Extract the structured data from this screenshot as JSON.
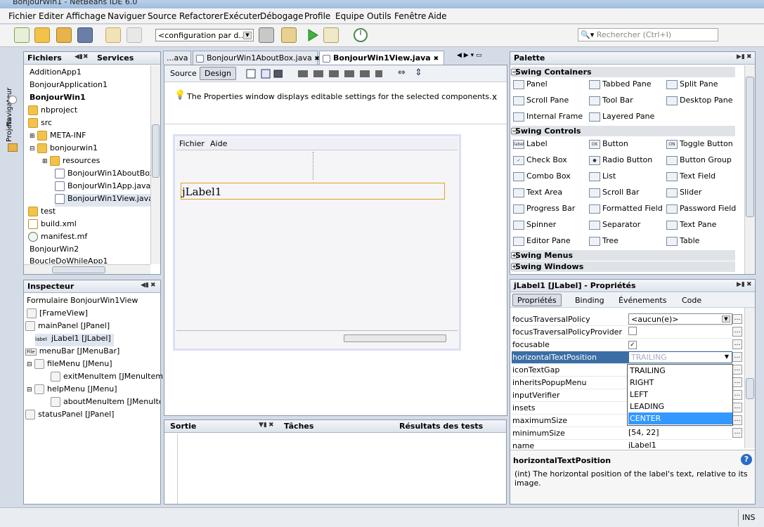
{
  "window": {
    "title": "BonjourWin1 - NetBeans IDE 6.0"
  },
  "menu": [
    "Fichier",
    "Editer",
    "Affichage",
    "Naviguer",
    "Source",
    "Refactorer",
    "Exécuter",
    "Débogage",
    "Profile",
    "Equipe",
    "Outils",
    "Fenêtre",
    "Aide"
  ],
  "toolbar": {
    "config": "<configuration par d...",
    "search_placeholder": "Rechercher (Ctrl+I)"
  },
  "left_strip": {
    "navigateur": "Navigateur",
    "projets": "Projets"
  },
  "files": {
    "tab1": "Fichiers",
    "tab2": "Services",
    "items": [
      "AdditionApp1",
      "BonjourApplication1",
      "BonjourWin1",
      "nbproject",
      "src",
      "META-INF",
      "bonjourwin1",
      "resources",
      "BonjourWin1AboutBox.",
      "BonjourWin1App.java",
      "BonjourWin1View.java",
      "test",
      "build.xml",
      "manifest.mf",
      "BonjourWin2",
      "BoucleDoWhileApp1"
    ]
  },
  "inspector": {
    "title": "Inspecteur",
    "items": [
      "Formulaire BonjourWin1View",
      "[FrameView]",
      "mainPanel [JPanel]",
      "jLabel1 [JLabel]",
      "menuBar [JMenuBar]",
      "fileMenu [JMenu]",
      "exitMenuItem [JMenuItem]",
      "helpMenu [JMenu]",
      "aboutMenuItem [JMenuItem]",
      "statusPanel [JPanel]"
    ],
    "label_icon_text": "label",
    "file_icon_text": "File"
  },
  "editor": {
    "tabs": [
      "...ava",
      "BonjourWin1AboutBox.java",
      "BonjourWin1View.java"
    ],
    "source": "Source",
    "design": "Design",
    "hint": "The Properties window displays editable settings for the selected components.",
    "close": "x",
    "form_menu": [
      "Fichier",
      "Aide"
    ],
    "label": "jLabel1"
  },
  "bottom": {
    "tabs": [
      "Sortie",
      "Tâches",
      "Résultats des tests"
    ]
  },
  "palette": {
    "title": "Palette",
    "sections": [
      {
        "name": "Swing Containers",
        "items": [
          "Panel",
          "Tabbed Pane",
          "Split Pane",
          "Scroll Pane",
          "Tool Bar",
          "Desktop Pane",
          "Internal Frame",
          "Layered Pane"
        ]
      },
      {
        "name": "Swing Controls",
        "items": [
          "Label",
          "Button",
          "Toggle Button",
          "Check Box",
          "Radio Button",
          "Button Group",
          "Combo Box",
          "List",
          "Text Field",
          "Text Area",
          "Scroll Bar",
          "Slider",
          "Progress Bar",
          "Formatted Field",
          "Password Field",
          "Spinner",
          "Separator",
          "Text Pane",
          "Editor Pane",
          "Tree",
          "Table"
        ]
      },
      {
        "name": "Swing Menus",
        "items": []
      },
      {
        "name": "Swing Windows",
        "items": []
      }
    ],
    "icon_texts": [
      "label",
      "OK",
      "ON"
    ]
  },
  "properties": {
    "title": "jLabel1 [JLabel] - Propriétés",
    "tabs": [
      "Propriétés",
      "Binding",
      "Événements",
      "Code"
    ],
    "rows": [
      {
        "k": "focusTraversalPolicy",
        "v": "<aucun(e)>"
      },
      {
        "k": "focusTraversalPolicyProvider",
        "v": ""
      },
      {
        "k": "focusable",
        "v": "✓"
      },
      {
        "k": "horizontalTextPosition",
        "v": "TRAILING"
      },
      {
        "k": "iconTextGap",
        "v": ""
      },
      {
        "k": "inheritsPopupMenu",
        "v": ""
      },
      {
        "k": "inputVerifier",
        "v": ""
      },
      {
        "k": "insets",
        "v": ""
      },
      {
        "k": "maximumSize",
        "v": ""
      },
      {
        "k": "minimumSize",
        "v": "[54, 22]"
      },
      {
        "k": "name",
        "v": "jLabel1"
      }
    ],
    "dropdown": [
      "TRAILING",
      "RIGHT",
      "LEFT",
      "LEADING",
      "CENTER"
    ],
    "desc_title": "horizontalTextPosition",
    "desc_text": "(int) The horizontal position of the label's text, relative to its image."
  },
  "status": {
    "ins": "INS"
  }
}
